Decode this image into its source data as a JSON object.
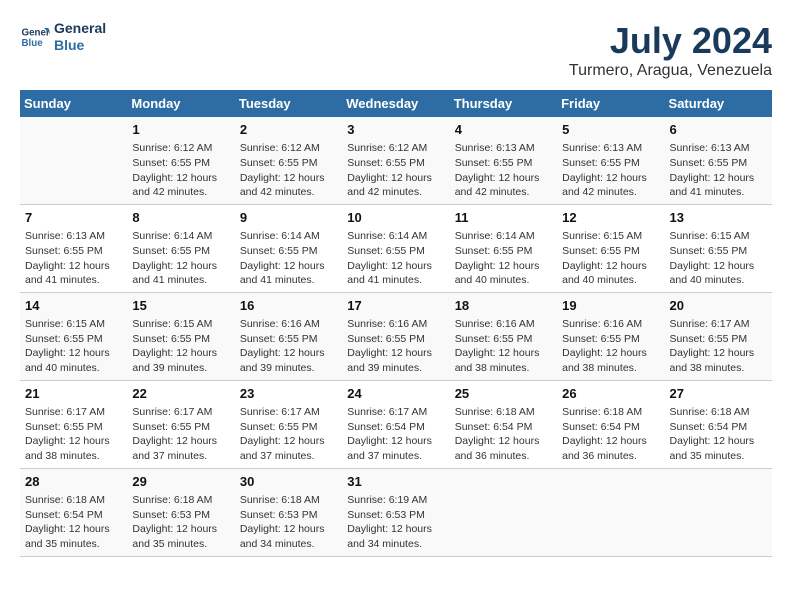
{
  "header": {
    "logo_line1": "General",
    "logo_line2": "Blue",
    "title": "July 2024",
    "subtitle": "Turmero, Aragua, Venezuela"
  },
  "days_of_week": [
    "Sunday",
    "Monday",
    "Tuesday",
    "Wednesday",
    "Thursday",
    "Friday",
    "Saturday"
  ],
  "weeks": [
    [
      {
        "day": "",
        "info": ""
      },
      {
        "day": "1",
        "info": "Sunrise: 6:12 AM\nSunset: 6:55 PM\nDaylight: 12 hours\nand 42 minutes."
      },
      {
        "day": "2",
        "info": "Sunrise: 6:12 AM\nSunset: 6:55 PM\nDaylight: 12 hours\nand 42 minutes."
      },
      {
        "day": "3",
        "info": "Sunrise: 6:12 AM\nSunset: 6:55 PM\nDaylight: 12 hours\nand 42 minutes."
      },
      {
        "day": "4",
        "info": "Sunrise: 6:13 AM\nSunset: 6:55 PM\nDaylight: 12 hours\nand 42 minutes."
      },
      {
        "day": "5",
        "info": "Sunrise: 6:13 AM\nSunset: 6:55 PM\nDaylight: 12 hours\nand 42 minutes."
      },
      {
        "day": "6",
        "info": "Sunrise: 6:13 AM\nSunset: 6:55 PM\nDaylight: 12 hours\nand 41 minutes."
      }
    ],
    [
      {
        "day": "7",
        "info": "Sunrise: 6:13 AM\nSunset: 6:55 PM\nDaylight: 12 hours\nand 41 minutes."
      },
      {
        "day": "8",
        "info": "Sunrise: 6:14 AM\nSunset: 6:55 PM\nDaylight: 12 hours\nand 41 minutes."
      },
      {
        "day": "9",
        "info": "Sunrise: 6:14 AM\nSunset: 6:55 PM\nDaylight: 12 hours\nand 41 minutes."
      },
      {
        "day": "10",
        "info": "Sunrise: 6:14 AM\nSunset: 6:55 PM\nDaylight: 12 hours\nand 41 minutes."
      },
      {
        "day": "11",
        "info": "Sunrise: 6:14 AM\nSunset: 6:55 PM\nDaylight: 12 hours\nand 40 minutes."
      },
      {
        "day": "12",
        "info": "Sunrise: 6:15 AM\nSunset: 6:55 PM\nDaylight: 12 hours\nand 40 minutes."
      },
      {
        "day": "13",
        "info": "Sunrise: 6:15 AM\nSunset: 6:55 PM\nDaylight: 12 hours\nand 40 minutes."
      }
    ],
    [
      {
        "day": "14",
        "info": "Sunrise: 6:15 AM\nSunset: 6:55 PM\nDaylight: 12 hours\nand 40 minutes."
      },
      {
        "day": "15",
        "info": "Sunrise: 6:15 AM\nSunset: 6:55 PM\nDaylight: 12 hours\nand 39 minutes."
      },
      {
        "day": "16",
        "info": "Sunrise: 6:16 AM\nSunset: 6:55 PM\nDaylight: 12 hours\nand 39 minutes."
      },
      {
        "day": "17",
        "info": "Sunrise: 6:16 AM\nSunset: 6:55 PM\nDaylight: 12 hours\nand 39 minutes."
      },
      {
        "day": "18",
        "info": "Sunrise: 6:16 AM\nSunset: 6:55 PM\nDaylight: 12 hours\nand 38 minutes."
      },
      {
        "day": "19",
        "info": "Sunrise: 6:16 AM\nSunset: 6:55 PM\nDaylight: 12 hours\nand 38 minutes."
      },
      {
        "day": "20",
        "info": "Sunrise: 6:17 AM\nSunset: 6:55 PM\nDaylight: 12 hours\nand 38 minutes."
      }
    ],
    [
      {
        "day": "21",
        "info": "Sunrise: 6:17 AM\nSunset: 6:55 PM\nDaylight: 12 hours\nand 38 minutes."
      },
      {
        "day": "22",
        "info": "Sunrise: 6:17 AM\nSunset: 6:55 PM\nDaylight: 12 hours\nand 37 minutes."
      },
      {
        "day": "23",
        "info": "Sunrise: 6:17 AM\nSunset: 6:55 PM\nDaylight: 12 hours\nand 37 minutes."
      },
      {
        "day": "24",
        "info": "Sunrise: 6:17 AM\nSunset: 6:54 PM\nDaylight: 12 hours\nand 37 minutes."
      },
      {
        "day": "25",
        "info": "Sunrise: 6:18 AM\nSunset: 6:54 PM\nDaylight: 12 hours\nand 36 minutes."
      },
      {
        "day": "26",
        "info": "Sunrise: 6:18 AM\nSunset: 6:54 PM\nDaylight: 12 hours\nand 36 minutes."
      },
      {
        "day": "27",
        "info": "Sunrise: 6:18 AM\nSunset: 6:54 PM\nDaylight: 12 hours\nand 35 minutes."
      }
    ],
    [
      {
        "day": "28",
        "info": "Sunrise: 6:18 AM\nSunset: 6:54 PM\nDaylight: 12 hours\nand 35 minutes."
      },
      {
        "day": "29",
        "info": "Sunrise: 6:18 AM\nSunset: 6:53 PM\nDaylight: 12 hours\nand 35 minutes."
      },
      {
        "day": "30",
        "info": "Sunrise: 6:18 AM\nSunset: 6:53 PM\nDaylight: 12 hours\nand 34 minutes."
      },
      {
        "day": "31",
        "info": "Sunrise: 6:19 AM\nSunset: 6:53 PM\nDaylight: 12 hours\nand 34 minutes."
      },
      {
        "day": "",
        "info": ""
      },
      {
        "day": "",
        "info": ""
      },
      {
        "day": "",
        "info": ""
      }
    ]
  ]
}
